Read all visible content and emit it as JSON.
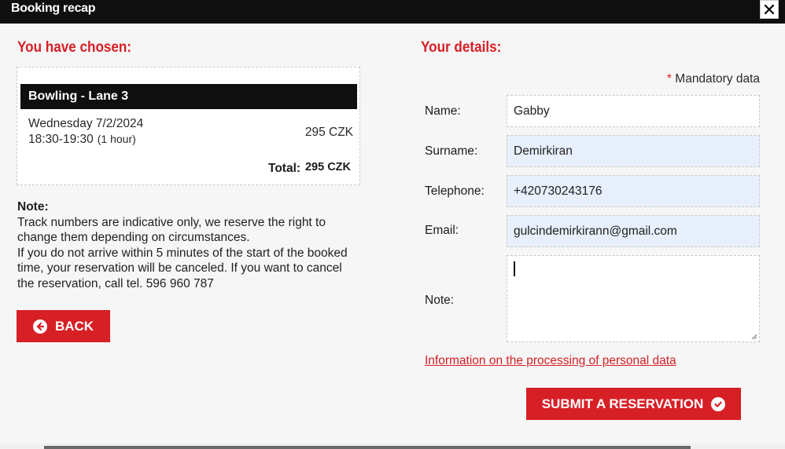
{
  "window": {
    "title": "Booking recap",
    "close_label": "✕"
  },
  "left": {
    "heading": "You have chosen:",
    "booking": {
      "item": "Bowling - Lane 3",
      "date": "Wednesday 7/2/2024",
      "time": "18:30-19:30",
      "duration": "(1 hour)",
      "price": "295 CZK",
      "total_label": "Total:",
      "total_value": "295 CZK"
    },
    "note": {
      "title": "Note:",
      "line1": "Track numbers are indicative only, we reserve the right to change them depending on circumstances.",
      "line2": "If you do not arrive within 5 minutes of the start of the booked time, your reservation will be canceled. If you want to cancel the reservation, call tel. 596 960 787"
    },
    "back_label": "BACK"
  },
  "right": {
    "heading": "Your details:",
    "mandatory_star": "*",
    "mandatory_text": "Mandatory data",
    "fields": {
      "name": {
        "label": "Name:",
        "value": "Gabby"
      },
      "surname": {
        "label": "Surname:",
        "value": "Demirkiran"
      },
      "telephone": {
        "label": "Telephone:",
        "value": "+420730243176"
      },
      "email": {
        "label": "Email:",
        "value": "gulcindemirkirann@gmail.com"
      },
      "note": {
        "label": "Note:",
        "value": ""
      }
    },
    "privacy_link": "Information on the processing of personal data",
    "submit_label": "SUBMIT A RESERVATION"
  },
  "colors": {
    "accent": "#d71f26",
    "titlebar": "#0f0f0f",
    "autofill": "#e8effd"
  },
  "icons": {
    "back": "arrow-left-circle-icon",
    "submit": "check-circle-icon",
    "close": "close-icon"
  }
}
